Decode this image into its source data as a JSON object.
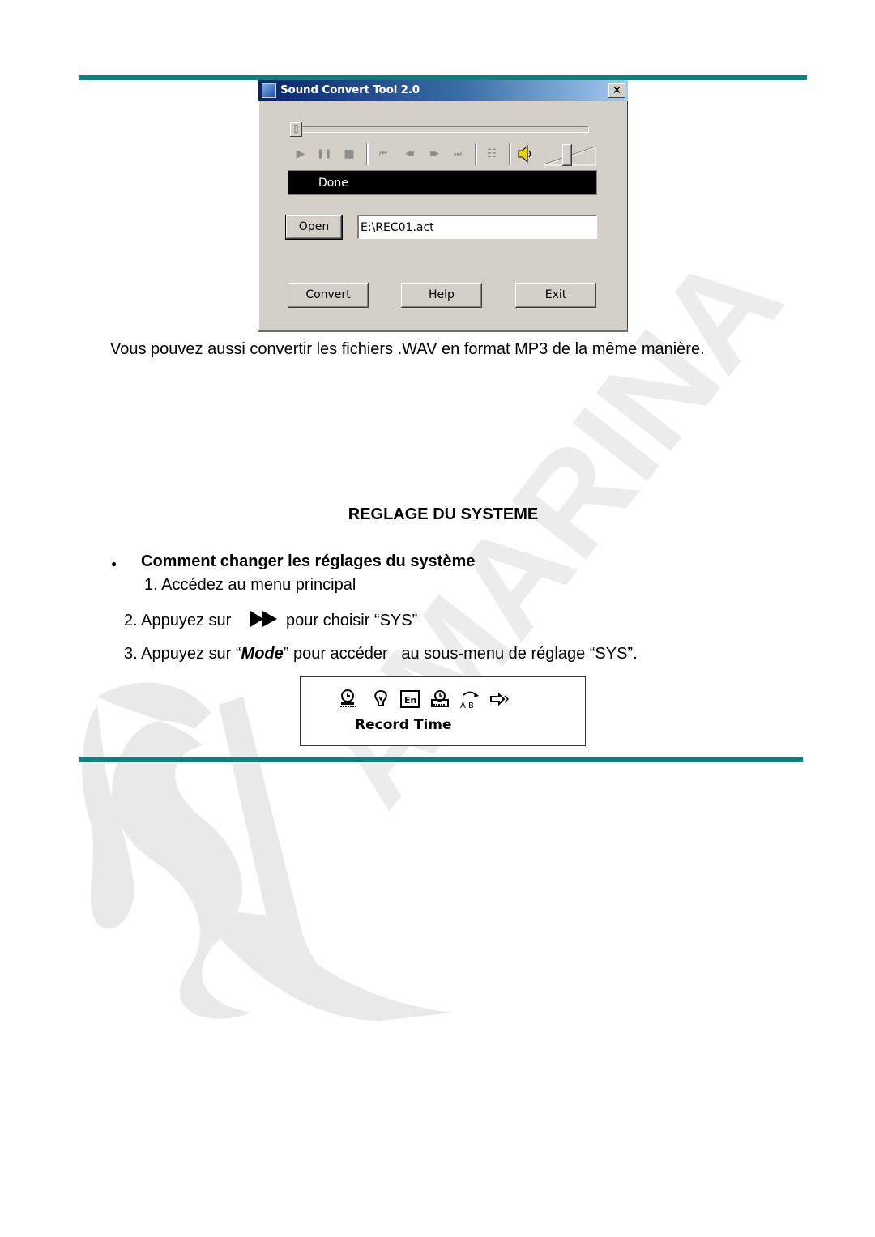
{
  "dialog": {
    "title": "Sound Convert Tool 2.0",
    "close_label": "✕",
    "seek_thumb_glyph": "⌷",
    "transport": [
      {
        "name": "play",
        "glyph": "▶"
      },
      {
        "name": "pause",
        "glyph": "❚❚"
      },
      {
        "name": "stop",
        "glyph": "■"
      },
      {
        "name": "previous",
        "glyph": "⏮"
      },
      {
        "name": "rewind",
        "glyph": "◀◀"
      },
      {
        "name": "fast-forward",
        "glyph": "▶▶"
      },
      {
        "name": "next",
        "glyph": "⏭"
      },
      {
        "name": "playlist",
        "glyph": "☷"
      }
    ],
    "volume_level": 0.45,
    "status_text": "Done",
    "open_label": "Open",
    "file_path": "E:\\REC01.act",
    "convert_label": "Convert",
    "help_label": "Help",
    "exit_label": "Exit"
  },
  "document": {
    "paragraph": "Vous pouvez aussi convertir les fichiers .WAV en format MP3 de la même manière.",
    "section_heading": "REGLAGE DU SYSTEME",
    "bullet_glyph": "●",
    "bullet_heading": "Comment changer les réglages du système",
    "step1": "1. Accédez au menu principal",
    "step2_before": "2. Appuyez sur",
    "step2_after": "pour choisir “SYS”",
    "step3_before": "3. Appuyez sur “",
    "step3_mode": "Mode",
    "step3_after": "” pour accéder   au sous-menu de réglage “SYS”.",
    "lcd": {
      "icons": [
        "record-time-icon",
        "backlight-icon",
        "language-icon",
        "power-off-icon",
        "repeat-ab-icon",
        "exit-icon"
      ],
      "label": "Record Time"
    }
  },
  "colors": {
    "rule": "#0f7f7d",
    "dialog_bg": "#d4d0c8",
    "titlebar_start": "#0a246a",
    "titlebar_end": "#a6caf0"
  }
}
